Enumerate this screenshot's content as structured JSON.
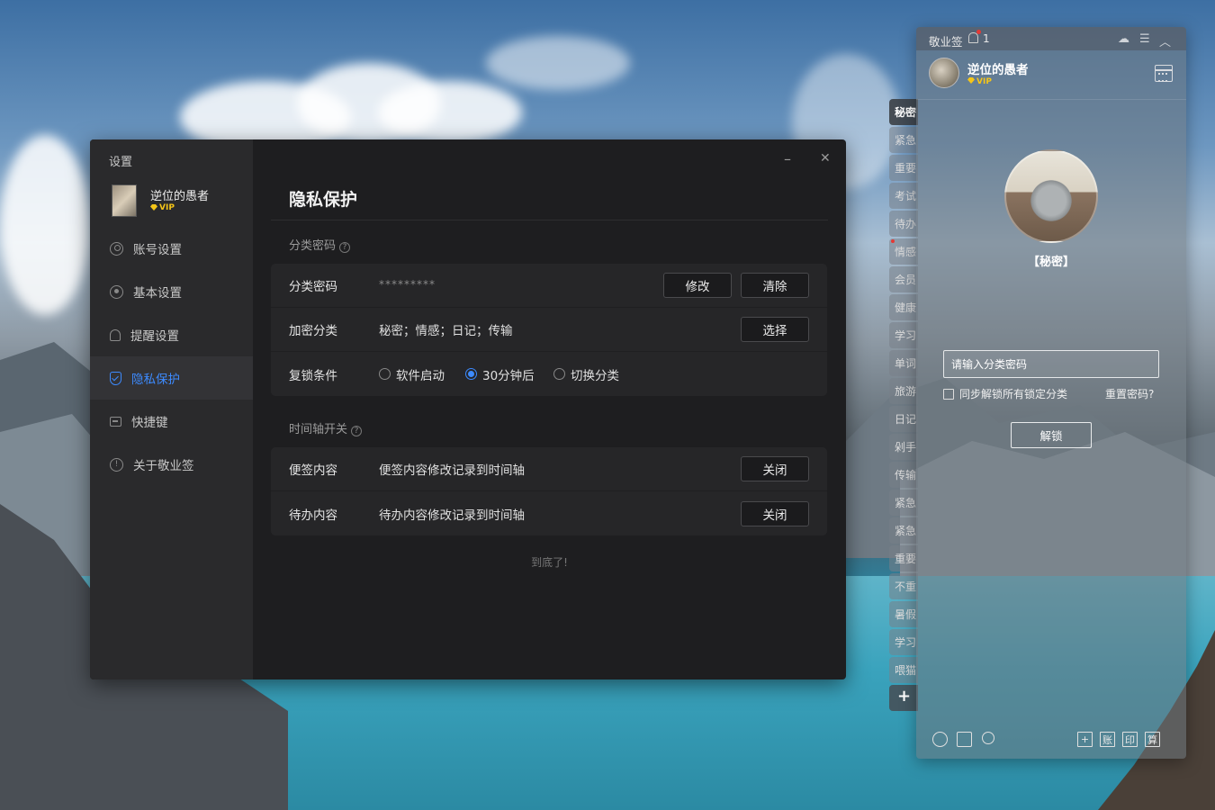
{
  "settings": {
    "title": "设置",
    "user": {
      "name": "逆位的愚者",
      "vip": "VIP"
    },
    "nav": [
      {
        "label": "账号设置",
        "icon": "account-icon"
      },
      {
        "label": "基本设置",
        "icon": "settings-icon"
      },
      {
        "label": "提醒设置",
        "icon": "bell-icon"
      },
      {
        "label": "隐私保护",
        "icon": "shield-icon",
        "active": true
      },
      {
        "label": "快捷键",
        "icon": "keyboard-icon"
      },
      {
        "label": "关于敬业签",
        "icon": "info-icon"
      }
    ],
    "window_controls": {
      "minimize": "–",
      "close": "✕"
    },
    "page_title": "隐私保护",
    "sections": {
      "category_password": {
        "label": "分类密码",
        "rows": {
          "password": {
            "label": "分类密码",
            "value": "*********",
            "btn_modify": "修改",
            "btn_clear": "清除"
          },
          "encrypted": {
            "label": "加密分类",
            "value": "秘密；情感；日记；传输",
            "btn_select": "选择"
          },
          "relock": {
            "label": "复锁条件",
            "options": [
              "软件启动",
              "30分钟后",
              "切换分类"
            ],
            "selected": "30分钟后"
          }
        }
      },
      "timeline": {
        "label": "时间轴开关",
        "rows": {
          "note": {
            "label": "便签内容",
            "value": "便签内容修改记录到时间轴",
            "btn": "关闭"
          },
          "todo": {
            "label": "待办内容",
            "value": "待办内容修改记录到时间轴",
            "btn": "关闭"
          }
        }
      }
    },
    "end_note": "到底了!",
    "help_glyph": "?"
  },
  "tabs": [
    "秘密",
    "紧急",
    "重要",
    "考试",
    "待办",
    "情感",
    "会员",
    "健康",
    "学习",
    "单词",
    "旅游",
    "日记",
    "剁手",
    "传输",
    "紧急",
    "紧急",
    "重要",
    "不重",
    "暑假",
    "学习",
    "喂猫"
  ],
  "tab_add": "+",
  "note": {
    "app_name": "敬业签",
    "notify_count": "1",
    "user": {
      "name": "逆位的愚者",
      "vip": "VIP"
    },
    "category_label": "【秘密】",
    "password_placeholder": "请输入分类密码",
    "sync_label": "同步解锁所有锁定分类",
    "reset_link": "重置密码?",
    "unlock_btn": "解锁",
    "bottom_icons": [
      "clock-icon",
      "todo-check-icon",
      "search-icon",
      "add-icon",
      "account-book-icon",
      "print-icon",
      "calculator-icon"
    ],
    "bottom_glyphs": {
      "add": "+",
      "account": "账",
      "print": "印",
      "calc": "算"
    },
    "top_icons": {
      "cloud": "☁",
      "menu": "☰",
      "collapse": "︿"
    }
  },
  "colors": {
    "accent": "#3d8bff",
    "vip": "#f5c518",
    "notify": "#e53935"
  }
}
